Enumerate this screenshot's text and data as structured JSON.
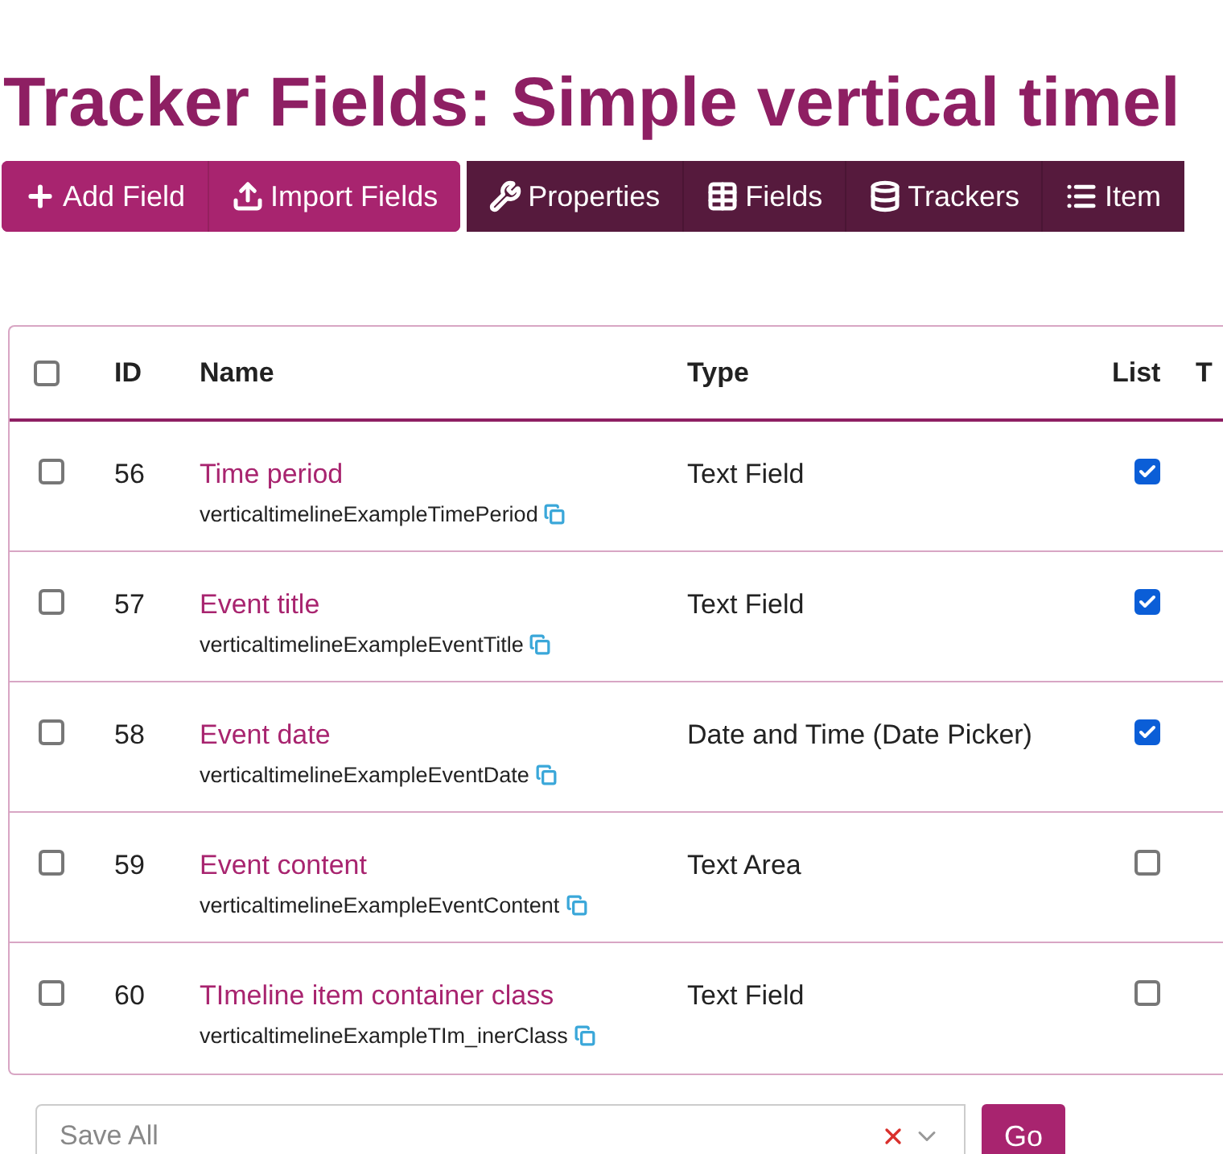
{
  "title": "Tracker Fields: Simple vertical timel",
  "toolbar": {
    "primary": [
      {
        "label": "Add Field"
      },
      {
        "label": "Import Fields"
      }
    ],
    "secondary": [
      {
        "label": "Properties"
      },
      {
        "label": "Fields"
      },
      {
        "label": "Trackers"
      },
      {
        "label": "Item"
      }
    ]
  },
  "table": {
    "select_all": {
      "checked": false
    },
    "columns": [
      "ID",
      "Name",
      "Type",
      "List",
      "T"
    ],
    "rows": [
      {
        "checked": false,
        "id": "56",
        "name": "Time period",
        "perm_name": "verticaltimelineExampleTimePeriod",
        "type": "Text Field",
        "list": true
      },
      {
        "checked": false,
        "id": "57",
        "name": "Event title",
        "perm_name": "verticaltimelineExampleEventTitle",
        "type": "Text Field",
        "list": true
      },
      {
        "checked": false,
        "id": "58",
        "name": "Event date",
        "perm_name": "verticaltimelineExampleEventDate",
        "type": "Date and Time (Date Picker)",
        "list": true
      },
      {
        "checked": false,
        "id": "59",
        "name": "Event content",
        "perm_name": "verticaltimelineExampleEventContent",
        "type": "Text Area",
        "list": false
      },
      {
        "checked": false,
        "id": "60",
        "name": "TImeline item container class",
        "perm_name": "verticaltimelineExampleTIm_inerClass",
        "type": "Text Field",
        "list": false
      }
    ]
  },
  "bulk_action": {
    "placeholder": "Save All",
    "button": "Go"
  }
}
